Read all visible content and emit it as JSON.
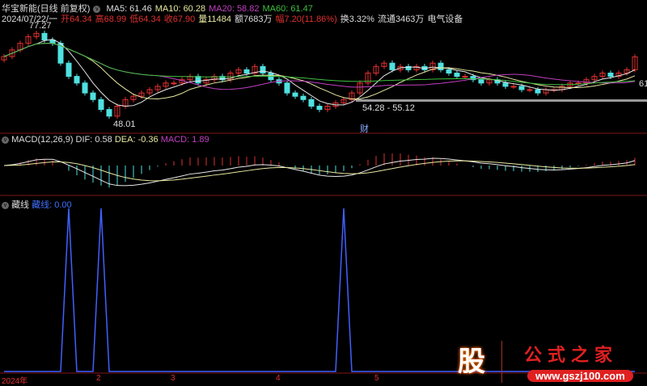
{
  "header": {
    "stock": "华宝新能(日线 前复权)",
    "ma5": "MA5: 61.46",
    "ma10": "MA10: 60.28",
    "ma20": "MA20: 58.82",
    "ma60": "MA60: 61.47"
  },
  "quote": {
    "date": "2024/07/22/一",
    "open": "开64.34",
    "high": "高68.99",
    "low": "低64.34",
    "close": "收67.90",
    "vol": "量11484",
    "amount": "额7683万",
    "change": "幅7.20(11.86%)",
    "turnover": "换3.32%",
    "float": "流通3463万",
    "sector": "电气设备"
  },
  "annotations": {
    "high": "77.27",
    "low": "48.01",
    "range": "54.28 - 55.12",
    "event": "财",
    "right_label": "61"
  },
  "macd": {
    "title": "MACD(12,26,9)",
    "dif": "DIF: 0.58",
    "dea": "DEA: -0.36",
    "macd": "MACD: 1.89"
  },
  "indicator": {
    "title": "藏线",
    "line": "藏线: 0.00"
  },
  "axis": {
    "labels": [
      "2024年",
      "2",
      "3",
      "4",
      "5"
    ]
  },
  "logo": {
    "char": "股",
    "name": "公式之家",
    "url": "www.gszj100.com"
  },
  "colors": {
    "up": "#e03030",
    "down": "#50e0e0",
    "ma5": "#e8e8e8",
    "ma10": "#e8e8a0",
    "ma20": "#c040c0",
    "ma60": "#40c040",
    "spike": "#4060ff"
  },
  "chart_data": {
    "type": "candlestick",
    "closes": [
      68,
      70,
      72,
      74,
      75,
      73,
      72,
      66,
      62,
      60,
      57,
      55,
      52,
      50,
      53,
      55,
      56,
      57,
      58,
      59,
      60,
      60,
      61,
      62,
      60,
      61,
      62,
      61,
      63,
      64,
      63,
      65,
      63,
      61,
      60,
      57,
      56,
      55,
      53,
      52,
      53,
      54,
      55,
      57,
      60,
      63,
      65,
      66,
      64,
      65,
      64,
      65,
      64,
      66,
      64,
      63,
      62,
      62,
      61,
      60,
      61,
      60,
      59,
      59,
      58,
      58,
      57,
      58,
      58,
      59,
      60,
      60,
      61,
      62,
      63,
      62,
      63,
      64,
      67.9
    ],
    "spike_indices": [
      8,
      12,
      42
    ]
  }
}
